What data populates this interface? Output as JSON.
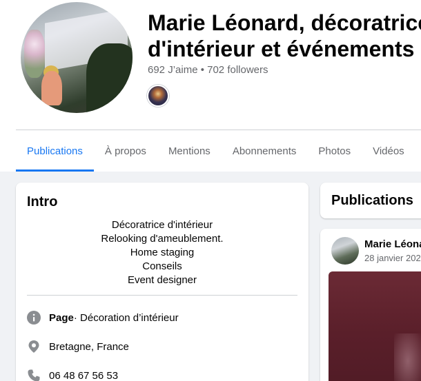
{
  "page": {
    "title_line1": "Marie Léonard, décoratrice",
    "title_line2": "d'intérieur et événements",
    "stats": "692 J’aime • 702 followers"
  },
  "tabs": [
    {
      "label": "Publications",
      "active": true
    },
    {
      "label": "À propos"
    },
    {
      "label": "Mentions"
    },
    {
      "label": "Abonnements"
    },
    {
      "label": "Photos"
    },
    {
      "label": "Vidéos"
    }
  ],
  "intro": {
    "title": "Intro",
    "bio": [
      "Décoratrice d'intérieur",
      "Relooking d'ameublement.",
      "Home staging",
      "Conseils",
      "Event designer"
    ],
    "page_label": "Page",
    "page_category": " · Décoration d’intérieur",
    "location": "Bretagne, France",
    "phone": "06 48 67 56 53"
  },
  "publications": {
    "title": "Publications",
    "post_author": "Marie Léona",
    "post_date": "28 janvier 202"
  },
  "icons": {
    "info": "info-icon",
    "location": "location-pin-icon",
    "phone": "phone-icon"
  },
  "colors": {
    "accent": "#1877f2",
    "muted_text": "#65676b",
    "icon_gray": "#8a8d91"
  }
}
